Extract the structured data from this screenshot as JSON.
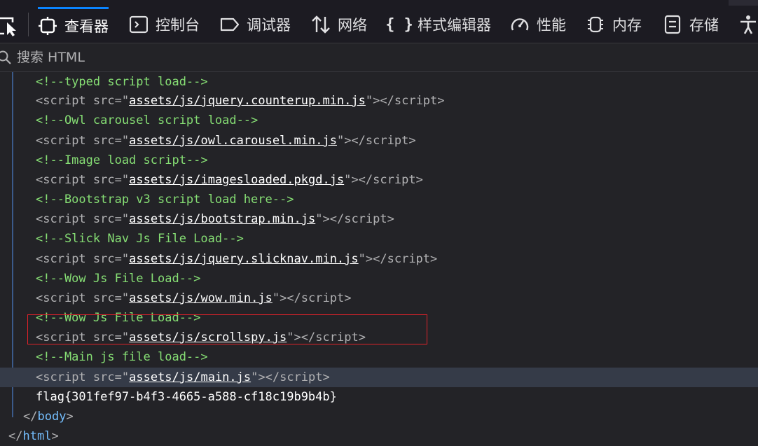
{
  "toolbar": {
    "tabs": [
      {
        "label": "查看器",
        "icon": "inspector-icon",
        "active": true
      },
      {
        "label": "控制台",
        "icon": "console-icon"
      },
      {
        "label": "调试器",
        "icon": "debugger-icon"
      },
      {
        "label": "网络",
        "icon": "network-icon"
      },
      {
        "label": "样式编辑器",
        "icon": "style-editor-icon"
      },
      {
        "label": "性能",
        "icon": "performance-icon"
      },
      {
        "label": "内存",
        "icon": "memory-icon"
      },
      {
        "label": "存储",
        "icon": "storage-icon"
      }
    ]
  },
  "search": {
    "placeholder": "搜索 HTML"
  },
  "tree": {
    "lines": [
      {
        "type": "comment",
        "text": "<!--typed script load-->"
      },
      {
        "type": "script",
        "src": "assets/js/jquery.counterup.min.js"
      },
      {
        "type": "comment",
        "text": "<!--Owl carousel script load-->"
      },
      {
        "type": "script",
        "src": "assets/js/owl.carousel.min.js"
      },
      {
        "type": "comment",
        "text": "<!--Image load script-->"
      },
      {
        "type": "script",
        "src": "assets/js/imagesloaded.pkgd.js"
      },
      {
        "type": "comment",
        "text": "<!--Bootstrap v3 script load here-->"
      },
      {
        "type": "script",
        "src": "assets/js/bootstrap.min.js"
      },
      {
        "type": "comment",
        "text": "<!--Slick Nav Js File Load-->"
      },
      {
        "type": "script",
        "src": "assets/js/jquery.slicknav.min.js"
      },
      {
        "type": "comment",
        "text": "<!--Wow Js File Load-->"
      },
      {
        "type": "script",
        "src": "assets/js/wow.min.js"
      },
      {
        "type": "comment",
        "text": "<!--Wow Js File Load-->"
      },
      {
        "type": "script",
        "src": "assets/js/scrollspy.js"
      },
      {
        "type": "comment",
        "text": "<!--Main js file load-->"
      },
      {
        "type": "script",
        "src": "assets/js/main.js",
        "selected": true
      },
      {
        "type": "text",
        "text": "flag{301fef97-b4f3-4665-a588-cf18c19b9b4b}"
      },
      {
        "type": "close",
        "tag": "body"
      },
      {
        "type": "close",
        "tag": "html"
      }
    ],
    "script_tag": "script",
    "src_attr": "src"
  },
  "colors": {
    "accent": "#0a84ff",
    "comment": "#86de74",
    "tag": "#75bfff",
    "highlight_border": "#e0222a"
  }
}
